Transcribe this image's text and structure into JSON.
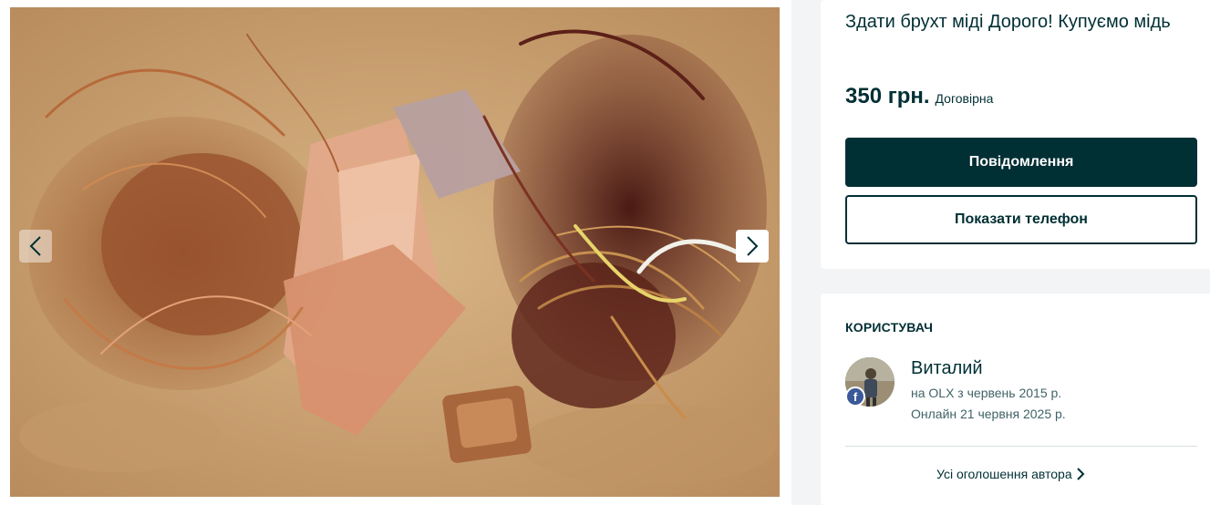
{
  "gallery": {
    "image_alt": "copper scrap wire and foil pile",
    "prev_icon": "chevron-left-icon",
    "next_icon": "chevron-right-icon"
  },
  "offer": {
    "title": "Здати брухт міді Дорого! Купуємо мідь",
    "price": "350 грн.",
    "negotiable": "Договірна",
    "message_button": "Повідомлення",
    "phone_button": "Показати телефон"
  },
  "user": {
    "heading": "Користувач",
    "name": "Виталий",
    "since": "на OLX з червень 2015 р.",
    "online": "Онлайн 21 червня 2025 р.",
    "badge_letter": "f",
    "all_ads": "Усі оголошення автора"
  },
  "colors": {
    "primary": "#002f34",
    "background": "#f2f4f5",
    "facebook": "#3b5998",
    "muted_text": "#406367"
  }
}
